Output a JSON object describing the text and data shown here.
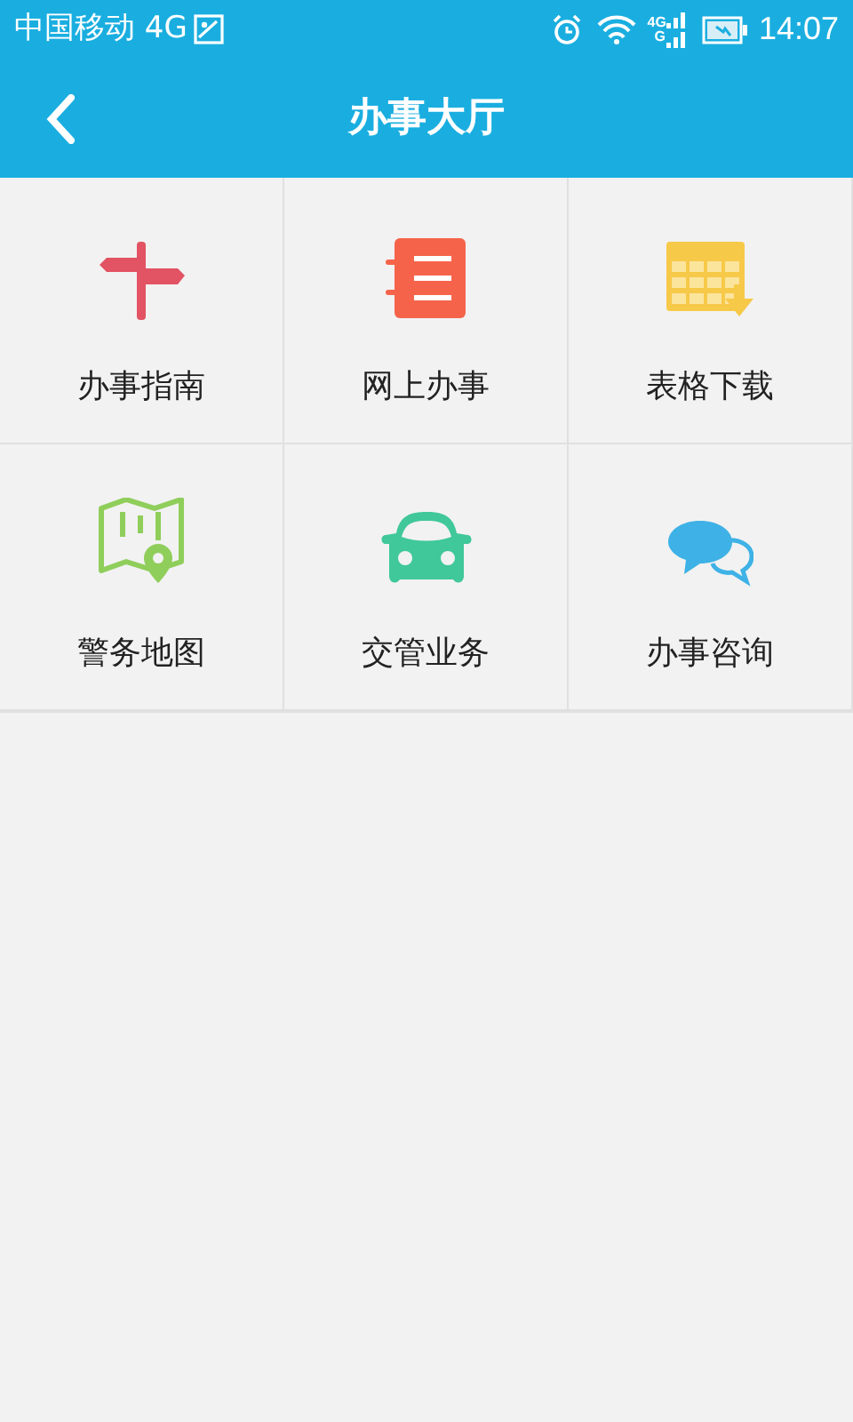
{
  "status_bar": {
    "carrier": "中国移动 4G",
    "network_top": "4G",
    "network_bottom": "G",
    "time": "14:07"
  },
  "title_bar": {
    "title": "办事大厅"
  },
  "grid": [
    {
      "kind": "signpost",
      "label": "办事指南"
    },
    {
      "kind": "notebook",
      "label": "网上办事"
    },
    {
      "kind": "table-download",
      "label": "表格下载"
    },
    {
      "kind": "map",
      "label": "警务地图"
    },
    {
      "kind": "car",
      "label": "交管业务"
    },
    {
      "kind": "chat",
      "label": "办事咨询"
    }
  ]
}
